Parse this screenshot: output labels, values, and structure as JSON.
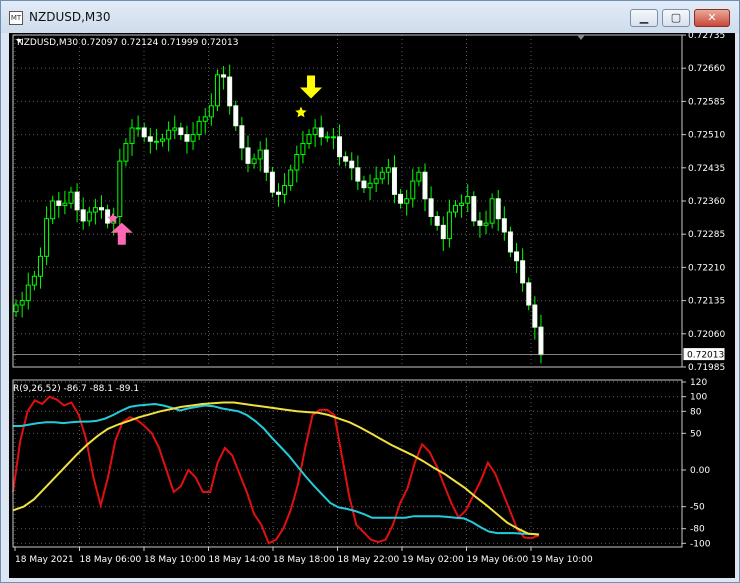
{
  "window": {
    "title": "NZDUSD,M30",
    "icon_label": "MT",
    "controls": {
      "minimize_icon": "minimize-icon",
      "maximize_icon": "maximize-icon",
      "close_icon": "close-icon"
    }
  },
  "chart_data": [
    {
      "type": "candlestick",
      "header": "NZDUSD,M30  0.72097 0.72124 0.71999 0.72013",
      "yticks": [
        "0.72735",
        "0.72660",
        "0.72585",
        "0.72510",
        "0.72435",
        "0.72360",
        "0.72285",
        "0.72210",
        "0.72135",
        "0.72060",
        "0.71985"
      ],
      "ylim": [
        0.71985,
        0.72735
      ],
      "current_price": "0.72013",
      "close": [
        0.72125,
        0.72135,
        0.7217,
        0.7219,
        0.72235,
        0.7232,
        0.7236,
        0.7235,
        0.72355,
        0.7238,
        0.7234,
        0.72315,
        0.72335,
        0.72345,
        0.7234,
        0.7231,
        0.72325,
        0.7245,
        0.7249,
        0.72525,
        0.72525,
        0.72505,
        0.72495,
        0.72495,
        0.725,
        0.7252,
        0.72525,
        0.7251,
        0.72495,
        0.7251,
        0.7254,
        0.7255,
        0.72575,
        0.72645,
        0.7264,
        0.72575,
        0.7253,
        0.7248,
        0.72445,
        0.72455,
        0.72475,
        0.72425,
        0.7238,
        0.72375,
        0.72395,
        0.7243,
        0.72465,
        0.7249,
        0.7251,
        0.72525,
        0.72505,
        0.72505,
        0.72505,
        0.7246,
        0.7245,
        0.72435,
        0.72405,
        0.7239,
        0.724,
        0.7241,
        0.72425,
        0.72435,
        0.72375,
        0.72355,
        0.72365,
        0.72405,
        0.72425,
        0.72365,
        0.72325,
        0.72305,
        0.72275,
        0.72335,
        0.7235,
        0.72355,
        0.7237,
        0.72315,
        0.72305,
        0.7231,
        0.72365,
        0.7232,
        0.7229,
        0.72245,
        0.72225,
        0.72175,
        0.72125,
        0.72075,
        0.72013
      ],
      "markers": [
        {
          "type": "buy",
          "index": 17,
          "price": 0.7232,
          "color": "#ff69b4"
        },
        {
          "type": "sell",
          "index": 48,
          "price": 0.7256,
          "color": "#ffff00"
        }
      ],
      "xticks": [
        "18 May 2021",
        "18 May 06:00",
        "18 May 10:00",
        "18 May 14:00",
        "18 May 18:00",
        "18 May 22:00",
        "19 May 02:00",
        "19 May 06:00",
        "19 May 10:00"
      ]
    },
    {
      "type": "line",
      "header": "R(9,26,52) -86.7 -88.1 -89.1",
      "ylim": [
        -105,
        120
      ],
      "yticks": [
        "120",
        "100",
        "80",
        "50",
        "0.00",
        "-50",
        "-80",
        "-100"
      ],
      "series": [
        {
          "color": "#e01010",
          "values": [
            -30,
            40,
            80,
            95,
            90,
            100,
            96,
            88,
            92,
            75,
            42,
            -10,
            -48,
            -10,
            40,
            65,
            72,
            68,
            60,
            50,
            30,
            0,
            -30,
            -22,
            0,
            -10,
            -30,
            -30,
            10,
            30,
            20,
            -5,
            -30,
            -60,
            -75,
            -100,
            -95,
            -80,
            -55,
            -20,
            30,
            75,
            82,
            82,
            75,
            20,
            -35,
            -75,
            -85,
            -95,
            -98,
            -95,
            -75,
            -45,
            -25,
            10,
            35,
            25,
            5,
            -20,
            -45,
            -65,
            -55,
            -35,
            -15,
            10,
            -5,
            -30,
            -55,
            -80,
            -92,
            -93,
            -89
          ]
        },
        {
          "color": "#22ccdd",
          "values": [
            60,
            60,
            62,
            64,
            65,
            65,
            64,
            65,
            66,
            66,
            67,
            70,
            75,
            81,
            86,
            88,
            89,
            90,
            88,
            85,
            81,
            84,
            86,
            88,
            87,
            84,
            82,
            80,
            75,
            67,
            57,
            44,
            32,
            20,
            6,
            -8,
            -21,
            -33,
            -45,
            -51,
            -53,
            -56,
            -60,
            -65,
            -65,
            -65,
            -65,
            -65,
            -63,
            -63,
            -63,
            -63,
            -64,
            -65,
            -66,
            -71,
            -78,
            -84,
            -86,
            -86,
            -86,
            -87,
            -87,
            -88
          ]
        },
        {
          "color": "#f0e040",
          "values": [
            -55,
            -50,
            -40,
            -25,
            -10,
            5,
            20,
            34,
            46,
            56,
            62,
            67,
            72,
            76,
            80,
            83,
            86,
            88,
            90,
            91,
            92,
            92,
            90,
            88,
            86,
            84,
            82,
            80,
            79,
            78,
            75,
            70,
            65,
            58,
            50,
            42,
            34,
            27,
            20,
            12,
            3,
            -5,
            -15,
            -25,
            -37,
            -48,
            -60,
            -72,
            -80,
            -87,
            -88
          ]
        }
      ]
    }
  ]
}
